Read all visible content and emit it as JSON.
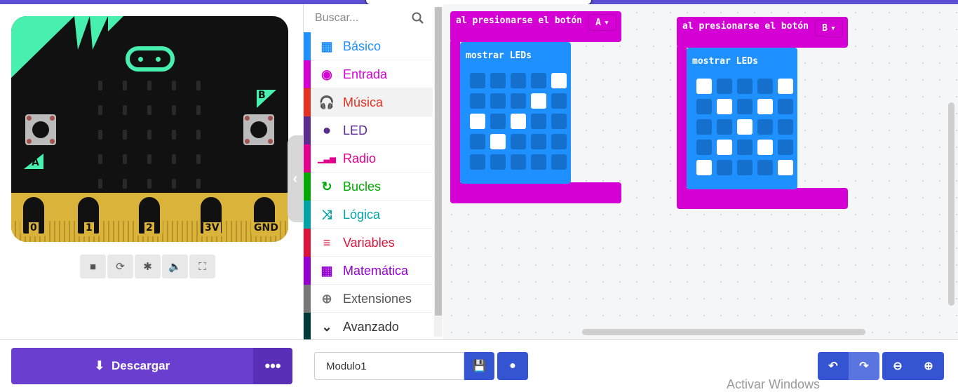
{
  "toolbox": {
    "search_placeholder": "Buscar...",
    "categories": [
      {
        "label": "Básico",
        "color": "#1e90ff",
        "icon": "grid-icon"
      },
      {
        "label": "Entrada",
        "color": "#d400d4",
        "icon": "target-icon"
      },
      {
        "label": "Música",
        "color": "#e63022",
        "icon": "headphones-icon"
      },
      {
        "label": "LED",
        "color": "#5c2d91",
        "icon": "toggle-icon"
      },
      {
        "label": "Radio",
        "color": "#e3008c",
        "icon": "signal-icon"
      },
      {
        "label": "Bucles",
        "color": "#00aa00",
        "icon": "refresh-icon"
      },
      {
        "label": "Lógica",
        "color": "#00a4a6",
        "icon": "shuffle-icon"
      },
      {
        "label": "Variables",
        "color": "#dc143c",
        "icon": "list-icon"
      },
      {
        "label": "Matemática",
        "color": "#9400d3",
        "icon": "calculator-icon"
      },
      {
        "label": "Extensiones",
        "color": "#777777",
        "icon": "plus-circle-icon"
      },
      {
        "label": "Avanzado",
        "color": "#003a3a",
        "icon": "chevron-down-icon"
      }
    ]
  },
  "simulator": {
    "pins": [
      "0",
      "1",
      "2",
      "3V",
      "GND"
    ],
    "button_a": "A",
    "button_b": "B"
  },
  "workspace": {
    "blocks": [
      {
        "event_label": "al presionarse el botón",
        "button": "A",
        "show_label": "mostrar LEDs",
        "leds": [
          [
            0,
            0,
            0,
            0,
            1
          ],
          [
            0,
            0,
            0,
            1,
            0
          ],
          [
            1,
            0,
            1,
            0,
            0
          ],
          [
            0,
            1,
            0,
            0,
            0
          ],
          [
            0,
            0,
            0,
            0,
            0
          ]
        ]
      },
      {
        "event_label": "al presionarse el botón",
        "button": "B",
        "show_label": "mostrar LEDs",
        "leds": [
          [
            1,
            0,
            0,
            0,
            1
          ],
          [
            0,
            1,
            0,
            1,
            0
          ],
          [
            0,
            0,
            1,
            0,
            0
          ],
          [
            0,
            1,
            0,
            1,
            0
          ],
          [
            1,
            0,
            0,
            0,
            1
          ]
        ]
      }
    ]
  },
  "bottom": {
    "download_label": "Descargar",
    "more_label": "•••",
    "project_name": "Modulo1",
    "watermark": "Activar Windows"
  },
  "colors": {
    "event_block": "#d400d4",
    "show_block": "#1e90ff",
    "download": "#6a3fd0",
    "accent_blue": "#3454d1"
  }
}
